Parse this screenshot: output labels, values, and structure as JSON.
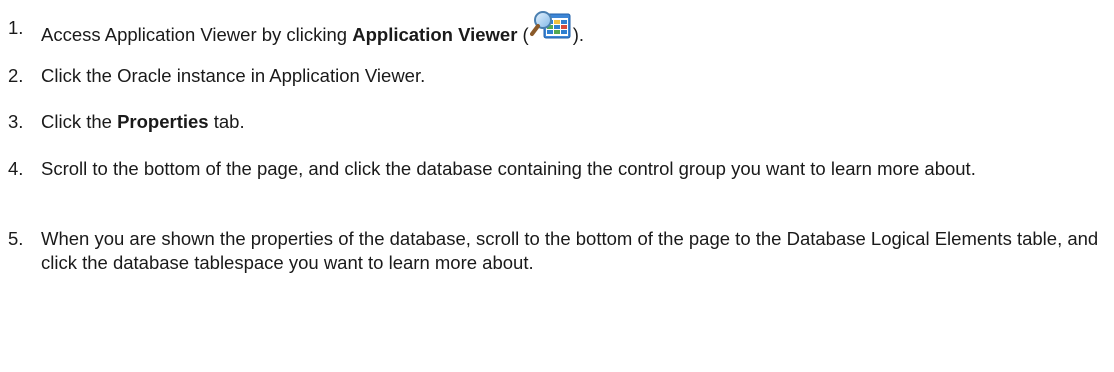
{
  "steps": [
    {
      "number": "1.",
      "text_before": "Access Application Viewer by clicking ",
      "bold": "Application Viewer",
      "text_after_open": " (",
      "icon": "application-viewer-icon",
      "text_after_close": ")."
    },
    {
      "number": "2.",
      "text": "Click the Oracle instance in Application Viewer."
    },
    {
      "number": "3.",
      "text_before": "Click the ",
      "bold": "Properties",
      "text_after": " tab."
    },
    {
      "number": "4.",
      "text": "Scroll to the bottom of the page, and click the database containing the control group you want to learn more about."
    },
    {
      "number": "5.",
      "text": "When you are shown the properties of the database, scroll to the bottom of the page to the Database Logical Elements table, and click the database tablespace you want to learn more about."
    }
  ]
}
